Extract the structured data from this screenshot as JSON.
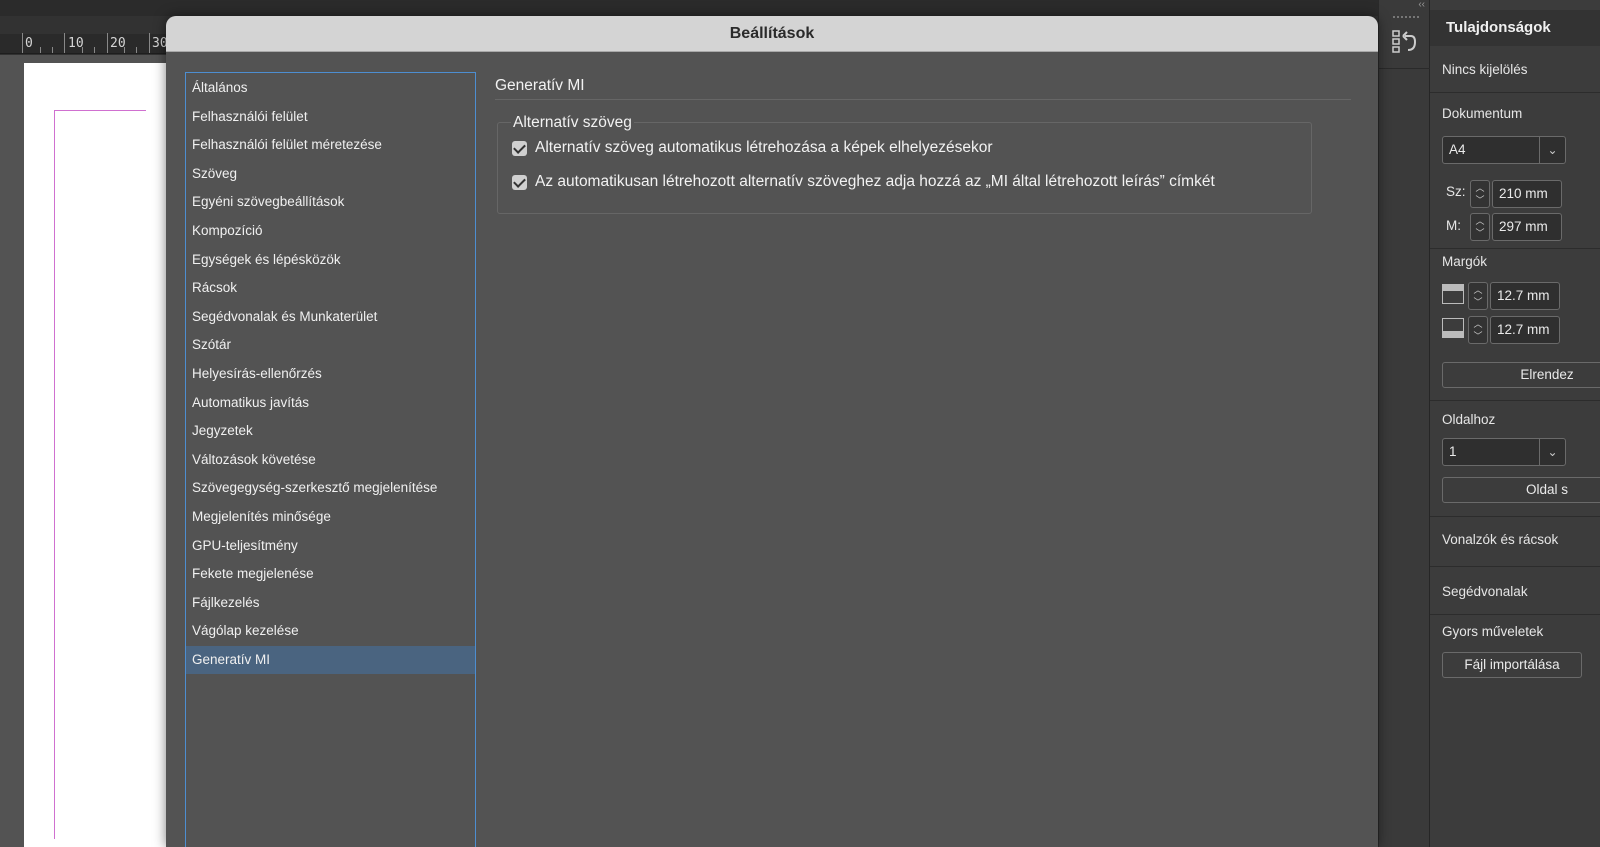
{
  "ruler": {
    "labels": [
      "0",
      "10",
      "20",
      "30"
    ]
  },
  "strip": {
    "collapse": "‹‹"
  },
  "dialog": {
    "title": "Beállítások",
    "categories": [
      "Általános",
      "Felhasználói felület",
      "Felhasználói felület méretezése",
      "Szöveg",
      "Egyéni szövegbeállítások",
      "Kompozíció",
      "Egységek és lépésközök",
      "Rácsok",
      "Segédvonalak és Munkaterület",
      "Szótár",
      "Helyesírás-ellenőrzés",
      "Automatikus javítás",
      "Jegyzetek",
      "Változások követése",
      "Szövegegység-szerkesztő megjelenítése",
      "Megjelenítés minősége",
      "GPU-teljesítmény",
      "Fekete megjelenése",
      "Fájlkezelés",
      "Vágólap kezelése",
      "Generatív MI"
    ],
    "selected_index": 20,
    "section_title": "Generatív MI",
    "group_title": "Alternatív szöveg",
    "options": [
      {
        "label": "Alternatív szöveg automatikus létrehozása a képek elhelyezésekor",
        "checked": true
      },
      {
        "label": "Az automatikusan létrehozott alternatív szöveghez adja hozzá az „MI által létrehozott leírás” címkét",
        "checked": true
      }
    ]
  },
  "properties": {
    "title": "Tulajdonságok",
    "no_selection": "Nincs kijelölés",
    "document_label": "Dokumentum",
    "page_size": "A4",
    "width_label": "Sz:",
    "width_value": "210 mm",
    "height_label": "M:",
    "height_value": "297 mm",
    "margins_label": "Margók",
    "margin_top": "12.7 mm",
    "margin_bottom": "12.7 mm",
    "arrange_button": "Elrendez",
    "page_label": "Oldalhoz",
    "page_value": "1",
    "page_button": "Oldal s",
    "rulers_label": "Vonalzók és rácsok",
    "guides_label": "Segédvonalak",
    "quick_actions_label": "Gyors műveletek",
    "import_button": "Fájl importálása"
  }
}
